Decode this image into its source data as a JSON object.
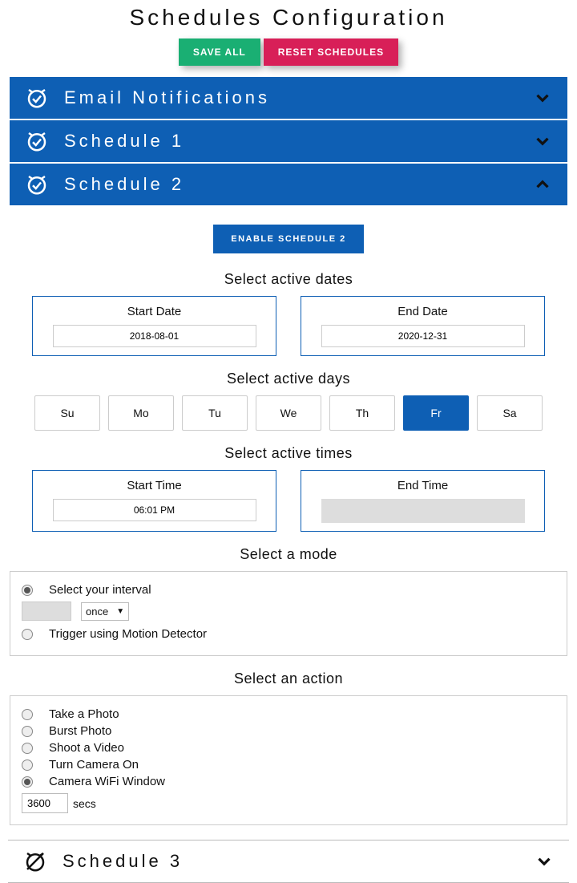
{
  "title": "Schedules Configuration",
  "buttons": {
    "save": "SAVE ALL",
    "reset": "RESET SCHEDULES"
  },
  "headers": {
    "email": "Email Notifications",
    "sched1": "Schedule 1",
    "sched2": "Schedule 2",
    "sched3": "Schedule 3"
  },
  "enable_btn": "ENABLE SCHEDULE 2",
  "labels": {
    "active_dates": "Select active dates",
    "start_date": "Start Date",
    "end_date": "End Date",
    "active_days": "Select active days",
    "active_times": "Select active times",
    "start_time": "Start Time",
    "end_time": "End Time",
    "mode": "Select a mode",
    "action": "Select an action"
  },
  "dates": {
    "start": "2018-08-01",
    "end": "2020-12-31"
  },
  "days": [
    "Su",
    "Mo",
    "Tu",
    "We",
    "Th",
    "Fr",
    "Sa"
  ],
  "active_day_index": 5,
  "times": {
    "start": "06:01 PM",
    "end": ""
  },
  "mode": {
    "interval_label": "Select your interval",
    "interval_value": "",
    "interval_unit": "once",
    "motion_label": "Trigger using Motion Detector"
  },
  "actions": {
    "photo": "Take a Photo",
    "burst": "Burst Photo",
    "video": "Shoot a Video",
    "camera_on": "Turn Camera On",
    "wifi": "Camera WiFi Window",
    "wifi_secs": "3600",
    "secs_label": "secs"
  }
}
